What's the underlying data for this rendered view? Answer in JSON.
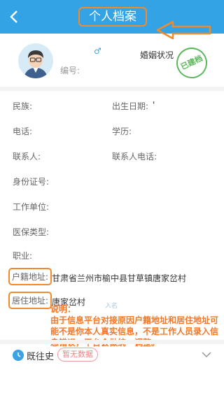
{
  "header": {
    "back_icon": "chevron-left-icon",
    "title": "个人档案",
    "arrow_color": "#f08a2a"
  },
  "profile": {
    "gender_symbol": "♂",
    "marital_label": "婚姻状况",
    "id_label": "编号:",
    "stamp_text": "已建档"
  },
  "fields": {
    "ethnicity": "民族:",
    "birthdate": "出生日期:",
    "birthdate_value": "'",
    "phone": "电话:",
    "education": "学历:",
    "contact": "联系人:",
    "contact_phone": "联系人电话:",
    "id_card": "身份证号:",
    "workplace": "工作单位:",
    "insurance": "医保类型:",
    "occupation": "职业:",
    "hukou_label": "户籍地址:",
    "hukou_value": "甘肃省兰州市榆中县甘草镇唐家岔村",
    "residence_label": "居住地址:",
    "residence_value": "唐家岔村"
  },
  "note": {
    "title": "说明：",
    "body": "由于信息平台对接原因户籍地址和居住地址可能不是你本人真实信息，不是工作人员录入信息错误，平台会做统一调整。",
    "faded": "入名"
  },
  "history": {
    "label": "既往史",
    "badge": "暂无数据"
  },
  "colors": {
    "header_bg": "#33a3e6",
    "accent_orange": "#f08a2a",
    "stamp_green": "#5cb85c"
  }
}
